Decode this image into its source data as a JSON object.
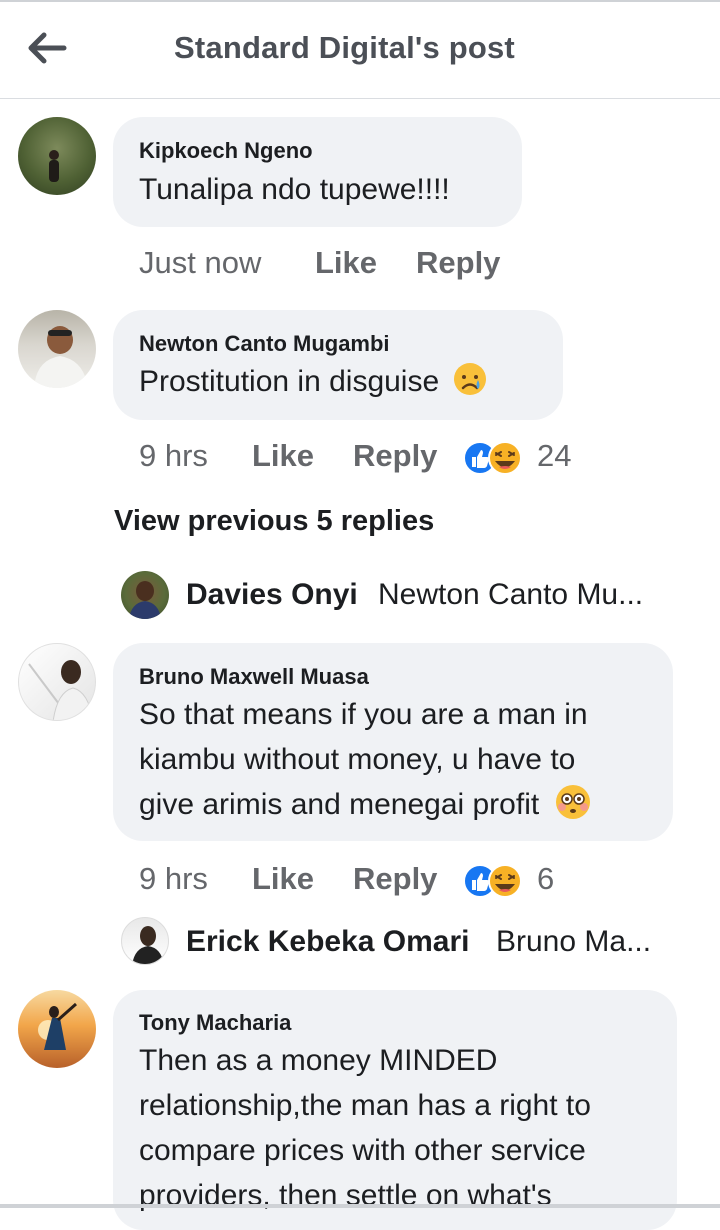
{
  "header": {
    "title": "Standard Digital's post",
    "back_icon": "arrow-left-icon"
  },
  "comments": [
    {
      "author": "Kipkoech Ngeno",
      "lines": [
        "Tunalipa ndo tupewe!!!!"
      ],
      "time": "Just now",
      "like": "Like",
      "reply": "Reply"
    },
    {
      "author": "Newton Canto Mugambi",
      "lines": [
        "Prostitution in disguise"
      ],
      "emoji": "crying-face-emoji",
      "time": "9 hrs",
      "like": "Like",
      "reply": "Reply",
      "reaction_count": "24",
      "reactions": [
        "like",
        "haha"
      ],
      "view_previous": "View previous 5 replies",
      "latest_reply": {
        "name": "Davies Onyi",
        "text": "Newton Canto Mu..."
      }
    },
    {
      "author": "Bruno Maxwell Muasa",
      "lines": [
        "So that means if you are a man in",
        "kiambu without money, u have to",
        "give arimis and menegai profit"
      ],
      "emoji": "flushed-face-emoji",
      "time": "9 hrs",
      "like": "Like",
      "reply": "Reply",
      "reaction_count": "6",
      "reactions": [
        "like",
        "haha"
      ],
      "latest_reply": {
        "name": "Erick Kebeka Omari",
        "text": "Bruno Ma..."
      }
    },
    {
      "author": "Tony Macharia",
      "lines": [
        "Then as a money MINDED",
        "relationship,the man has a right to",
        "compare prices with other service",
        "providers, then settle on what's"
      ]
    }
  ],
  "colors": {
    "bubble": "#f0f2f5",
    "meta": "#65676b",
    "like_blue": "#1877f2",
    "haha_yellow": "#f7b125"
  }
}
